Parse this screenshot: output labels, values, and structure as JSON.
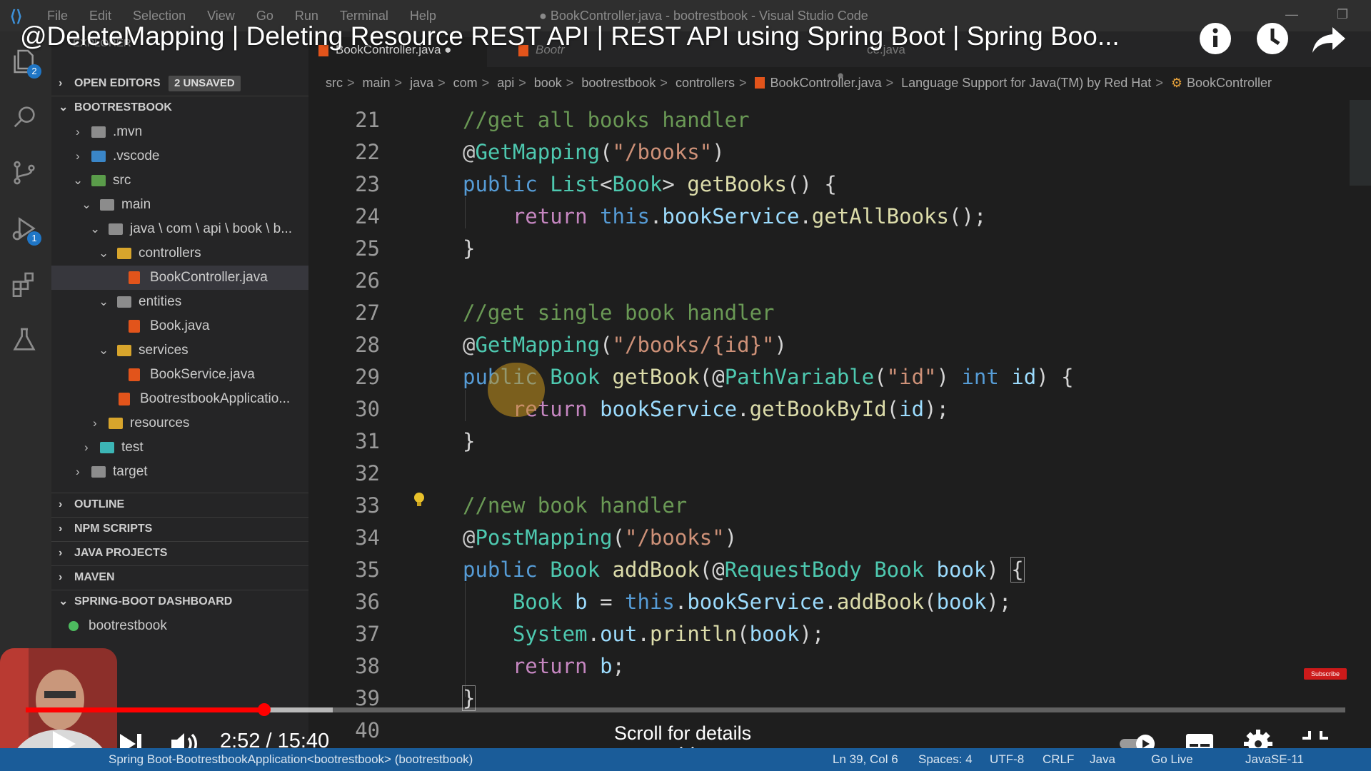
{
  "vscode": {
    "menu": [
      "File",
      "Edit",
      "Selection",
      "View",
      "Go",
      "Run",
      "Terminal",
      "Help"
    ],
    "window_title": "● BookController.java - bootrestbook - Visual Studio Code"
  },
  "activity": {
    "explorer_badge": "2",
    "run_badge": "1"
  },
  "sidebar": {
    "explorer_label": "EXPLORER",
    "open_editors": "OPEN EDITORS",
    "unsaved": "2 UNSAVED",
    "project": "BOOTRESTBOOK",
    "tree": [
      {
        "label": ".mvn"
      },
      {
        "label": ".vscode"
      },
      {
        "label": "src"
      },
      {
        "label": "main"
      },
      {
        "label": "java \\ com \\ api \\ book \\ b..."
      },
      {
        "label": "controllers"
      },
      {
        "label": "BookController.java"
      },
      {
        "label": "entities"
      },
      {
        "label": "Book.java"
      },
      {
        "label": "services"
      },
      {
        "label": "BookService.java"
      },
      {
        "label": "BootrestbookApplicatio..."
      },
      {
        "label": "resources"
      },
      {
        "label": "test"
      },
      {
        "label": "target"
      }
    ],
    "sections": [
      "OUTLINE",
      "NPM SCRIPTS",
      "JAVA PROJECTS",
      "MAVEN",
      "SPRING-BOOT DASHBOARD"
    ],
    "dashboard_item": "bootrestbook"
  },
  "tabs": {
    "active": "BookController.java",
    "second": "Bootr",
    "third": "ce.java"
  },
  "breadcrumb": {
    "items": [
      "src",
      "main",
      "java",
      "com",
      "api",
      "book",
      "bootrestbook",
      "controllers"
    ],
    "file": "BookController.java",
    "lang": "Language Support for Java(TM) by Red Hat",
    "class": "BookController"
  },
  "editor": {
    "line_numbers": [
      "21",
      "22",
      "23",
      "24",
      "25",
      "26",
      "27",
      "28",
      "29",
      "30",
      "31",
      "32",
      "33",
      "34",
      "35",
      "36",
      "37",
      "38",
      "39",
      "40"
    ]
  },
  "youtube": {
    "title": "@DeleteMapping | Deleting Resource REST API | REST API using Spring Boot | Spring Boo...",
    "time": "2:52 / 15:40",
    "progress_fraction": 0.181,
    "scroll_hint": "Scroll for details",
    "subscribe": "Subscribe"
  },
  "status": {
    "left": "Spring Boot-BootrestbookApplication<bootrestbook> (bootrestbook)",
    "position": "Ln 39, Col 6",
    "spaces": "Spaces: 4",
    "encoding": "UTF-8",
    "eol": "CRLF",
    "language": "Java",
    "golive": "Go Live",
    "jdk": "JavaSE-11"
  },
  "colors": {
    "statusbar": "#1a5c99",
    "progress": "#ff0000",
    "comment": "#6a9955",
    "keyword": "#569cd6",
    "type": "#4ec9b0",
    "function": "#dcdcaa",
    "string": "#ce9178"
  }
}
